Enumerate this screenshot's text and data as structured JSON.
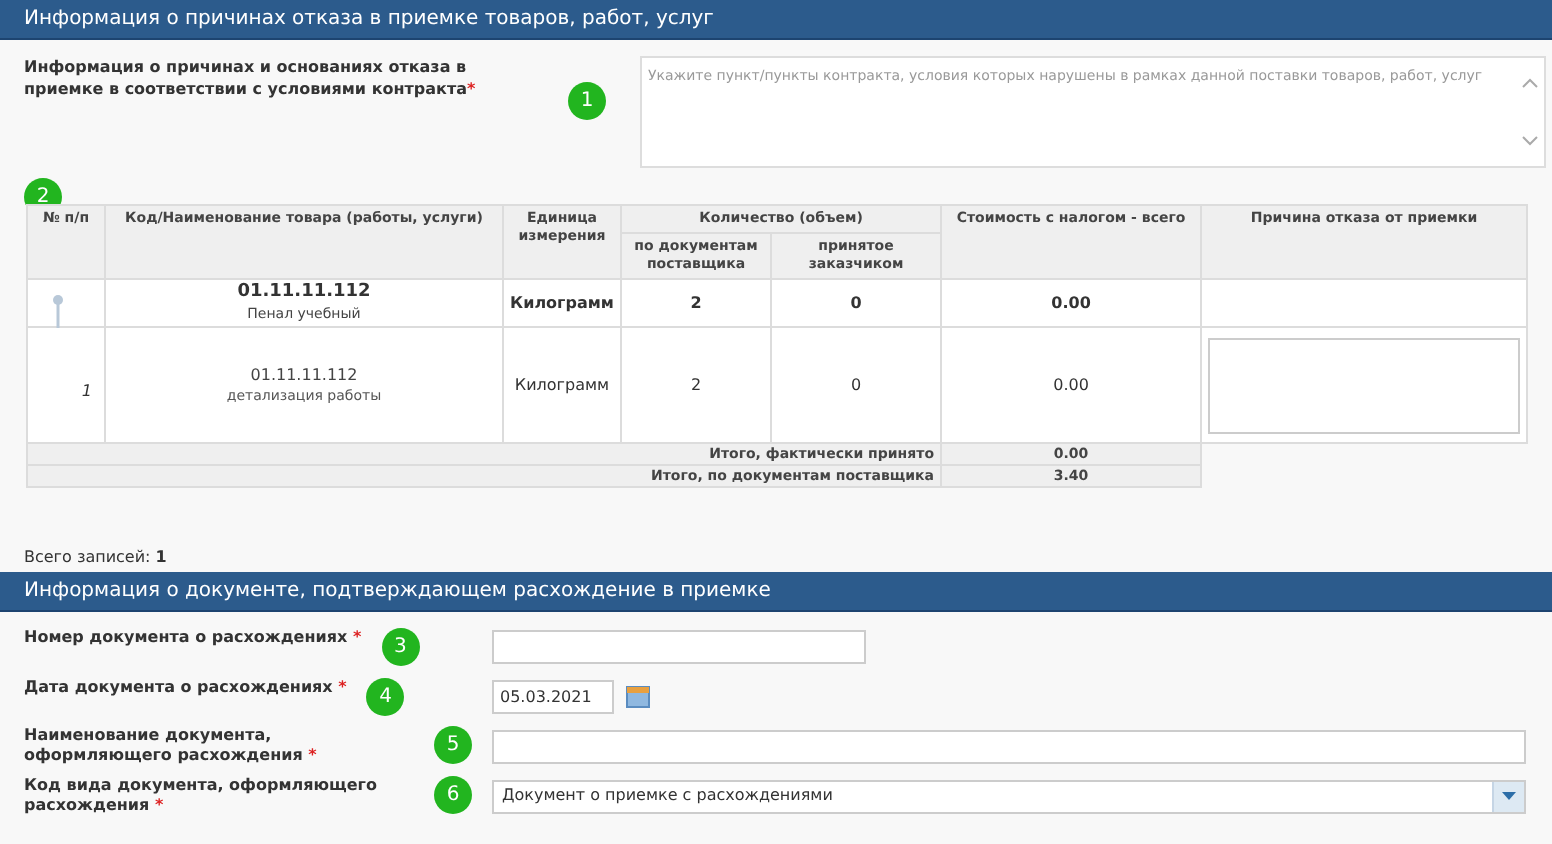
{
  "section_1": {
    "title": "Информация о причинах отказа в приемке товаров, работ, услуг"
  },
  "reasons_field": {
    "label": "Информация о причинах и основаниях отказа в приемке в соответствии с условиями контракта",
    "required_mark": "*",
    "marker": "1",
    "placeholder": "Укажите пункт/пункты контракта, условия которых нарушены в рамках данной поставки товаров, работ, услуг"
  },
  "table": {
    "marker": "2",
    "columns": {
      "number": "№ п/п",
      "code_name": "Код/Наименование товара (работы, услуги)",
      "unit": "Единица измерения",
      "quantity": "Количество (объем)",
      "qty_supplier": "по документам поставщика",
      "qty_accepted": "принятое заказчиком",
      "cost": "Стоимость с налогом - всего",
      "reason": "Причина отказа от приемки"
    },
    "rows": [
      {
        "kind": "parent",
        "number": "",
        "code": "01.11.11.112",
        "name": "Пенал учебный",
        "unit": "Килограмм",
        "qty_supplier": "2",
        "qty_accepted": "0",
        "cost": "0.00"
      },
      {
        "kind": "detail",
        "number": "1",
        "code": "01.11.11.112",
        "name": "детализация работы",
        "unit": "Килограмм",
        "qty_supplier": "2",
        "qty_accepted": "0",
        "cost": "0.00"
      }
    ],
    "totals": [
      {
        "label": "Итого, фактически принято",
        "value": "0.00"
      },
      {
        "label": "Итого, по документам поставщика",
        "value": "3.40"
      }
    ]
  },
  "total_records": "Всего записей: **1**",
  "section_2": {
    "title": "Информация о документе, подтверждающем расхождение в приемке"
  },
  "fields": [
    {
      "kind": "text",
      "label": "Номер документа о расхождениях",
      "required_mark": "*",
      "marker": "3"
    },
    {
      "kind": "date",
      "label": "Дата документа о расхождениях",
      "required_mark": "*",
      "marker": "4",
      "value": "05.03.2021"
    },
    {
      "kind": "wide",
      "label": "Наименование документа, оформляющего расхождения",
      "required_mark": "*",
      "marker": "5"
    },
    {
      "kind": "select",
      "label": "Код вида документа, оформляющего расхождения",
      "required_mark": "*",
      "marker": "6",
      "value": "Документ о приемке с расхождениями"
    }
  ]
}
